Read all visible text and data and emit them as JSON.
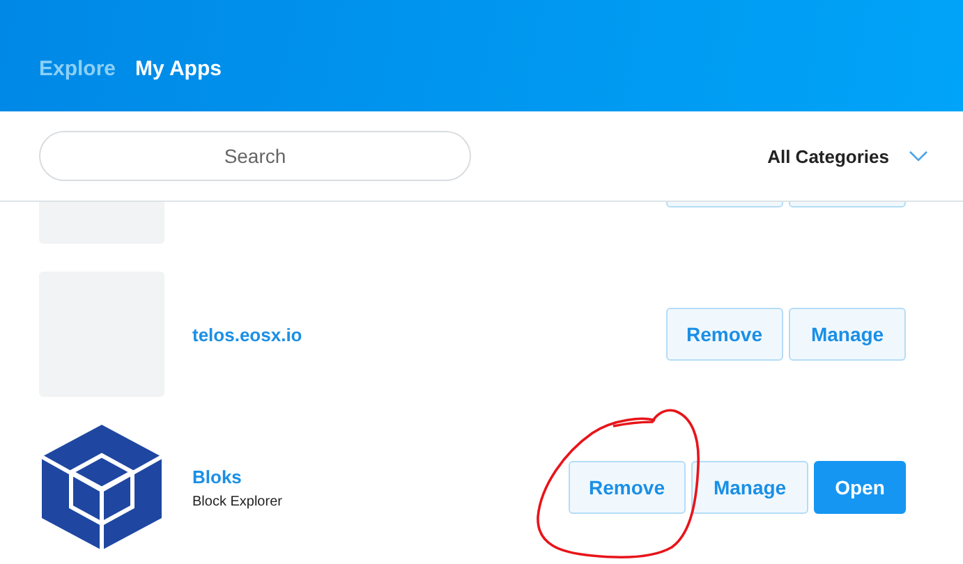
{
  "tabs": [
    {
      "label": "Explore",
      "selected": false
    },
    {
      "label": "My Apps",
      "selected": true
    }
  ],
  "search": {
    "placeholder": "Search"
  },
  "category_filter": {
    "value": "All Categories"
  },
  "apps": [
    {
      "icon": {
        "kind": "placeholder"
      },
      "actions": [
        {
          "kind": "secondary"
        },
        {
          "kind": "secondary"
        }
      ]
    },
    {
      "icon": {
        "kind": "placeholder"
      },
      "name": "telos.eosx.io",
      "actions": [
        {
          "kind": "secondary",
          "label": "Remove"
        },
        {
          "kind": "secondary",
          "label": "Manage"
        }
      ]
    },
    {
      "icon": {
        "kind": "cube"
      },
      "name": "Bloks",
      "subtitle": "Block Explorer",
      "actions": [
        {
          "kind": "secondary",
          "label": "Remove"
        },
        {
          "kind": "secondary",
          "label": "Manage"
        },
        {
          "kind": "primary",
          "label": "Open"
        }
      ]
    }
  ]
}
